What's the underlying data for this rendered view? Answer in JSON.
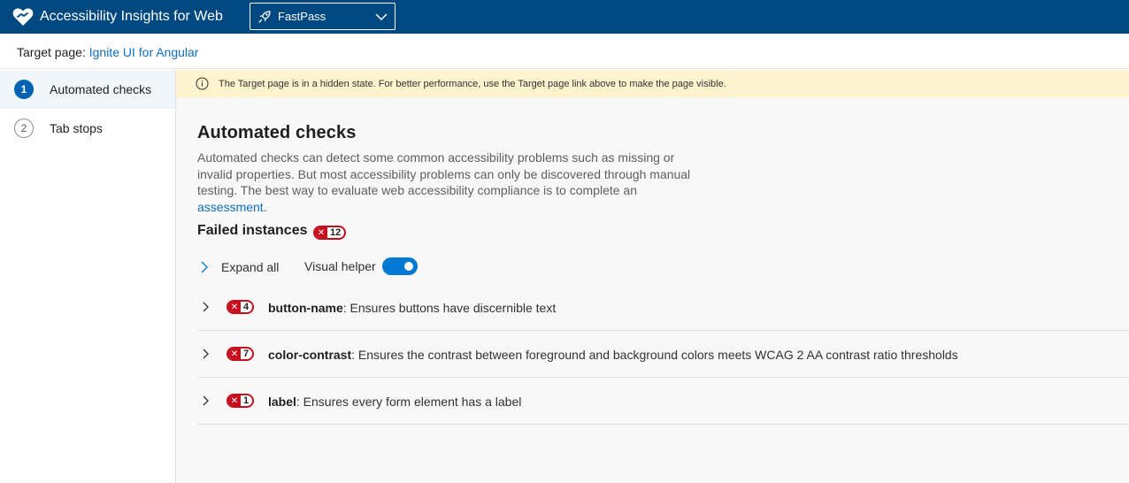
{
  "header": {
    "app_title": "Accessibility Insights for Web",
    "mode_label": "FastPass",
    "brand_color": "#004880"
  },
  "target": {
    "label": "Target page: ",
    "link_text": "Ignite UI for Angular"
  },
  "nav": {
    "items": [
      {
        "number": "1",
        "label": "Automated checks",
        "active": true
      },
      {
        "number": "2",
        "label": "Tab stops",
        "active": false
      }
    ]
  },
  "warning": {
    "text": "The Target page is in a hidden state. For better performance, use the Target page link above to make the page visible."
  },
  "main": {
    "title": "Automated checks",
    "description": "Automated checks can detect some common accessibility problems such as missing or invalid properties. But most accessibility problems can only be discovered through manual testing. The best way to evaluate web accessibility compliance is to complete an ",
    "description_link": "assessment",
    "description_end": ".",
    "failed_heading": "Failed instances",
    "failed_count": "12",
    "expand_all_label": "Expand all",
    "visual_helper_label": "Visual helper",
    "visual_helper_on": true
  },
  "rules": [
    {
      "count": "4",
      "name": "button-name",
      "description": ": Ensures buttons have discernible text"
    },
    {
      "count": "7",
      "name": "color-contrast",
      "description": ": Ensures the contrast between foreground and background colors meets WCAG 2 AA contrast ratio thresholds"
    },
    {
      "count": "1",
      "name": "label",
      "description": ": Ensures every form element has a label"
    }
  ],
  "icons": {
    "logo": "heart-hand-logo-icon",
    "mode": "rocket-icon",
    "dropdown": "chevron-down-icon",
    "info": "info-icon",
    "chevron": "chevron-right-icon",
    "error": "x-icon"
  },
  "colors": {
    "accent": "#0078d4",
    "link": "#106ebe",
    "error": "#c50f1f",
    "warning_bg": "#fff4ce"
  }
}
